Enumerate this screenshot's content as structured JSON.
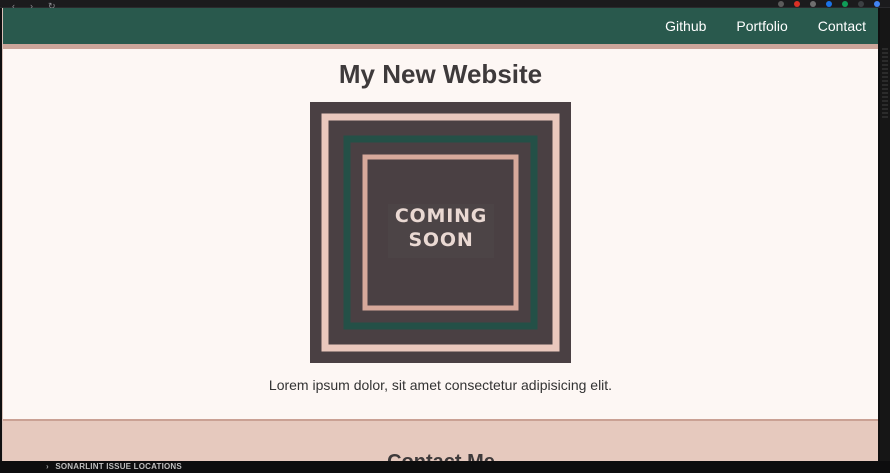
{
  "site": {
    "nav": [
      "Github",
      "Portfolio",
      "Contact"
    ],
    "title": "My New Website",
    "hero_text": [
      "COMING",
      "SOON"
    ],
    "body_text": "Lorem ipsum dolor, sit amet consectetur adipisicing elit.",
    "contact_heading": "Contact Me"
  },
  "ide": {
    "bottom_label": "SONARLINT ISSUE LOCATIONS"
  },
  "colors": {
    "nav_bg": "#29594d",
    "accent": "#cba59a",
    "page_bg": "#fdf7f4",
    "hero_bg": "#4a4043",
    "text": "#3e3a3b"
  }
}
